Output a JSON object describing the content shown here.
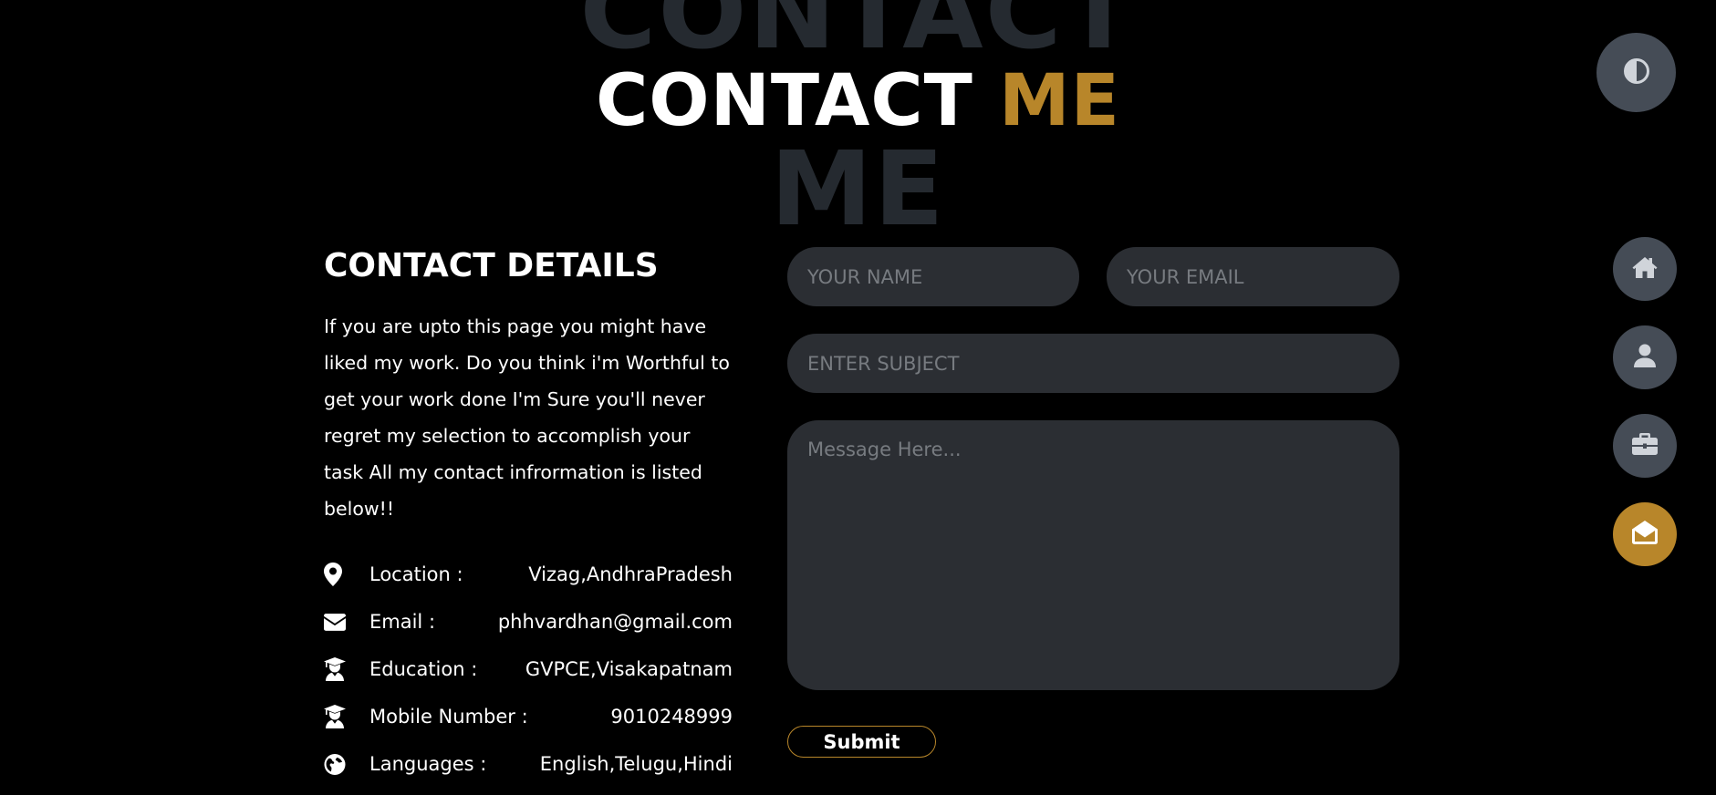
{
  "heading": {
    "background_word_top": "CONTACT",
    "background_word_bottom": "ME",
    "title_white": "CONTACT",
    "title_gold": "ME"
  },
  "details": {
    "title": "CONTACT DETAILS",
    "description": "If you are upto this page you might have liked my work. Do you think i'm Worthful to get your work done I'm Sure you'll never regret my selection to accomplish your task All my contact infrormation is listed below!!",
    "items": [
      {
        "icon": "location-pin-icon",
        "label": "Location :",
        "value": "Vizag,AndhraPradesh"
      },
      {
        "icon": "envelope-icon",
        "label": "Email :",
        "value": "phhvardhan@gmail.com"
      },
      {
        "icon": "graduate-icon",
        "label": "Education :",
        "value": "GVPCE,Visakapatnam"
      },
      {
        "icon": "graduate-icon",
        "label": "Mobile Number :",
        "value": "9010248999"
      },
      {
        "icon": "globe-icon",
        "label": "Languages :",
        "value": "English,Telugu,Hindi"
      }
    ]
  },
  "form": {
    "name_placeholder": "YOUR NAME",
    "email_placeholder": "YOUR EMAIL",
    "subject_placeholder": "ENTER SUBJECT",
    "message_placeholder": "Message Here...",
    "submit_label": "Submit"
  },
  "nav": {
    "theme_toggle_icon": "contrast-icon",
    "items": [
      {
        "icon": "home-icon",
        "active": false
      },
      {
        "icon": "user-icon",
        "active": false
      },
      {
        "icon": "briefcase-icon",
        "active": false
      },
      {
        "icon": "envelope-open-icon",
        "active": true
      }
    ]
  },
  "colors": {
    "background": "#000000",
    "accent": "#b8862a",
    "field": "#2b2e33",
    "nav_button": "#454c56"
  }
}
